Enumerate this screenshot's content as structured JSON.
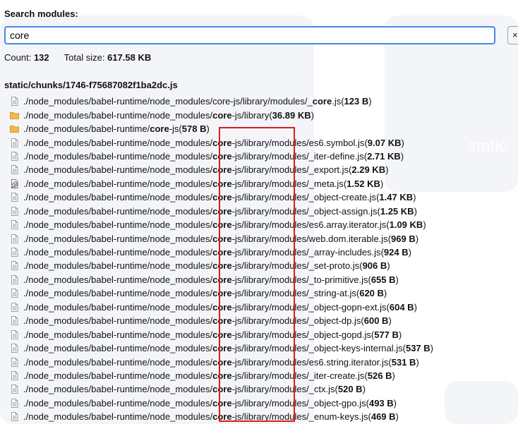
{
  "search": {
    "label": "Search modules:",
    "value": "core",
    "placeholder": "",
    "clear_label": "×"
  },
  "stats": {
    "count_label": "Count:",
    "count_value": "132",
    "size_label": "Total size:",
    "size_value": "617.58 KB"
  },
  "chunk": {
    "name": "static/chunks/1746-f75687082f1ba2dc.js"
  },
  "background_text": "static",
  "colors": {
    "accent": "#4a86e8",
    "highlight": "#e01b1b",
    "folder": "#f2b84b",
    "file": "#9aa0a6"
  },
  "modules": [
    {
      "icon": "file-icon",
      "before": "./node_modules/babel-runtime/node_modules/core-js/library/modules/_",
      "match": "core",
      "after": ".js",
      "size": "123 B"
    },
    {
      "icon": "folder-icon",
      "before": "./node_modules/babel-runtime/node_modules/",
      "match": "core",
      "after": "-js/library",
      "size": "36.89 KB"
    },
    {
      "icon": "folder-icon",
      "before": "./node_modules/babel-runtime/",
      "match": "core",
      "after": "-js",
      "size": "578 B"
    },
    {
      "icon": "file-icon",
      "before": "./node_modules/babel-runtime/node_modules/",
      "match": "core",
      "after": "-js/library/modules/es6.symbol.js",
      "size": "9.07 KB"
    },
    {
      "icon": "file-icon",
      "before": "./node_modules/babel-runtime/node_modules/",
      "match": "core",
      "after": "-js/library/modules/_iter-define.js",
      "size": "2.71 KB"
    },
    {
      "icon": "file-icon",
      "before": "./node_modules/babel-runtime/node_modules/",
      "match": "core",
      "after": "-js/library/modules/_export.js",
      "size": "2.29 KB"
    },
    {
      "icon": "concatenated-file-icon",
      "before": "./node_modules/babel-runtime/node_modules/",
      "match": "core",
      "after": "-js/library/modules/_meta.js",
      "size": "1.52 KB"
    },
    {
      "icon": "file-icon",
      "before": "./node_modules/babel-runtime/node_modules/",
      "match": "core",
      "after": "-js/library/modules/_object-create.js",
      "size": "1.47 KB"
    },
    {
      "icon": "file-icon",
      "before": "./node_modules/babel-runtime/node_modules/",
      "match": "core",
      "after": "-js/library/modules/_object-assign.js",
      "size": "1.25 KB"
    },
    {
      "icon": "file-icon",
      "before": "./node_modules/babel-runtime/node_modules/",
      "match": "core",
      "after": "-js/library/modules/es6.array.iterator.js",
      "size": "1.09 KB"
    },
    {
      "icon": "file-icon",
      "before": "./node_modules/babel-runtime/node_modules/",
      "match": "core",
      "after": "-js/library/modules/web.dom.iterable.js",
      "size": "969 B"
    },
    {
      "icon": "file-icon",
      "before": "./node_modules/babel-runtime/node_modules/",
      "match": "core",
      "after": "-js/library/modules/_array-includes.js",
      "size": "924 B"
    },
    {
      "icon": "file-icon",
      "before": "./node_modules/babel-runtime/node_modules/",
      "match": "core",
      "after": "-js/library/modules/_set-proto.js",
      "size": "906 B"
    },
    {
      "icon": "file-icon",
      "before": "./node_modules/babel-runtime/node_modules/",
      "match": "core",
      "after": "-js/library/modules/_to-primitive.js",
      "size": "655 B"
    },
    {
      "icon": "file-icon",
      "before": "./node_modules/babel-runtime/node_modules/",
      "match": "core",
      "after": "-js/library/modules/_string-at.js",
      "size": "620 B"
    },
    {
      "icon": "file-icon",
      "before": "./node_modules/babel-runtime/node_modules/",
      "match": "core",
      "after": "-js/library/modules/_object-gopn-ext.js",
      "size": "604 B"
    },
    {
      "icon": "file-icon",
      "before": "./node_modules/babel-runtime/node_modules/",
      "match": "core",
      "after": "-js/library/modules/_object-dp.js",
      "size": "600 B"
    },
    {
      "icon": "file-icon",
      "before": "./node_modules/babel-runtime/node_modules/",
      "match": "core",
      "after": "-js/library/modules/_object-gopd.js",
      "size": "577 B"
    },
    {
      "icon": "file-icon",
      "before": "./node_modules/babel-runtime/node_modules/",
      "match": "core",
      "after": "-js/library/modules/_object-keys-internal.js",
      "size": "537 B"
    },
    {
      "icon": "file-icon",
      "before": "./node_modules/babel-runtime/node_modules/",
      "match": "core",
      "after": "-js/library/modules/es6.string.iterator.js",
      "size": "531 B"
    },
    {
      "icon": "file-icon",
      "before": "./node_modules/babel-runtime/node_modules/",
      "match": "core",
      "after": "-js/library/modules/_iter-create.js",
      "size": "526 B"
    },
    {
      "icon": "file-icon",
      "before": "./node_modules/babel-runtime/node_modules/",
      "match": "core",
      "after": "-js/library/modules/_ctx.js",
      "size": "520 B"
    },
    {
      "icon": "file-icon",
      "before": "./node_modules/babel-runtime/node_modules/",
      "match": "core",
      "after": "-js/library/modules/_object-gpo.js",
      "size": "493 B"
    },
    {
      "icon": "file-icon",
      "before": "./node_modules/babel-runtime/node_modules/",
      "match": "core",
      "after": "-js/library/modules/_enum-keys.js",
      "size": "469 B"
    }
  ]
}
